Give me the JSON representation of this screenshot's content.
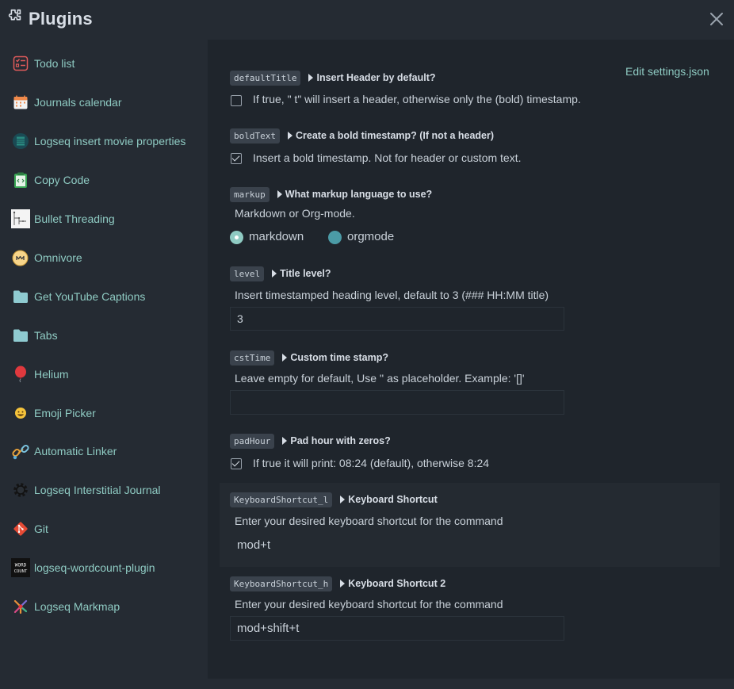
{
  "header": {
    "title": "Plugins"
  },
  "colors": {
    "accent": "#8fcbc3",
    "radio_selected": "#8fcbc3",
    "radio_unselected": "#4b9ba6"
  },
  "sidebar": {
    "items": [
      {
        "label": "Todo list",
        "icon": "todo-list-icon"
      },
      {
        "label": "Journals calendar",
        "icon": "calendar-icon"
      },
      {
        "label": "Logseq insert movie properties",
        "icon": "film-icon"
      },
      {
        "label": "Copy Code",
        "icon": "clipboard-code-icon"
      },
      {
        "label": "Bullet Threading",
        "icon": "bullet-threading-icon"
      },
      {
        "label": "Omnivore",
        "icon": "omnivore-icon"
      },
      {
        "label": "Get YouTube Captions",
        "icon": "folder-icon"
      },
      {
        "label": "Tabs",
        "icon": "folder-icon"
      },
      {
        "label": "Helium",
        "icon": "balloon-icon"
      },
      {
        "label": "Emoji Picker",
        "icon": "emoji-icon"
      },
      {
        "label": "Automatic Linker",
        "icon": "link-icon"
      },
      {
        "label": "Logseq Interstitial Journal",
        "icon": "gear-icon"
      },
      {
        "label": "Git",
        "icon": "git-icon"
      },
      {
        "label": "logseq-wordcount-plugin",
        "icon": "word-count-icon"
      },
      {
        "label": "Logseq Markmap",
        "icon": "markmap-icon"
      }
    ]
  },
  "settings": {
    "edit_link": "Edit settings.json",
    "defaultTitle": {
      "key": "defaultTitle",
      "title": "Insert Header by default?",
      "description": "If true, \" t\" will insert a header, otherwise only the (bold) timestamp.",
      "checked": false
    },
    "boldText": {
      "key": "boldText",
      "title": "Create a bold timestamp? (If not a header)",
      "description": "Insert a bold timestamp. Not for header or custom text.",
      "checked": true
    },
    "markup": {
      "key": "markup",
      "title": "What markup language to use?",
      "description": "Markdown or Org-mode.",
      "options": [
        "markdown",
        "orgmode"
      ],
      "selected": "markdown"
    },
    "level": {
      "key": "level",
      "title": "Title level?",
      "description": "Insert timestamped heading level, default to 3 (### HH:MM title)",
      "value": "3"
    },
    "cstTime": {
      "key": "cstTime",
      "title": "Custom time stamp?",
      "description": "Leave empty for default, Use '' as placeholder. Example: '[]'",
      "value": ""
    },
    "padHour": {
      "key": "padHour",
      "title": "Pad hour with zeros?",
      "description": "If true it will print: 08:24 (default), otherwise 8:24",
      "checked": true
    },
    "shortcut_l": {
      "key": "KeyboardShortcut_l",
      "title": "Keyboard Shortcut",
      "description": "Enter your desired keyboard shortcut for the command",
      "value": "mod+t"
    },
    "shortcut_h": {
      "key": "KeyboardShortcut_h",
      "title": "Keyboard Shortcut 2",
      "description": "Enter your desired keyboard shortcut for the command",
      "value": "mod+shift+t"
    }
  }
}
